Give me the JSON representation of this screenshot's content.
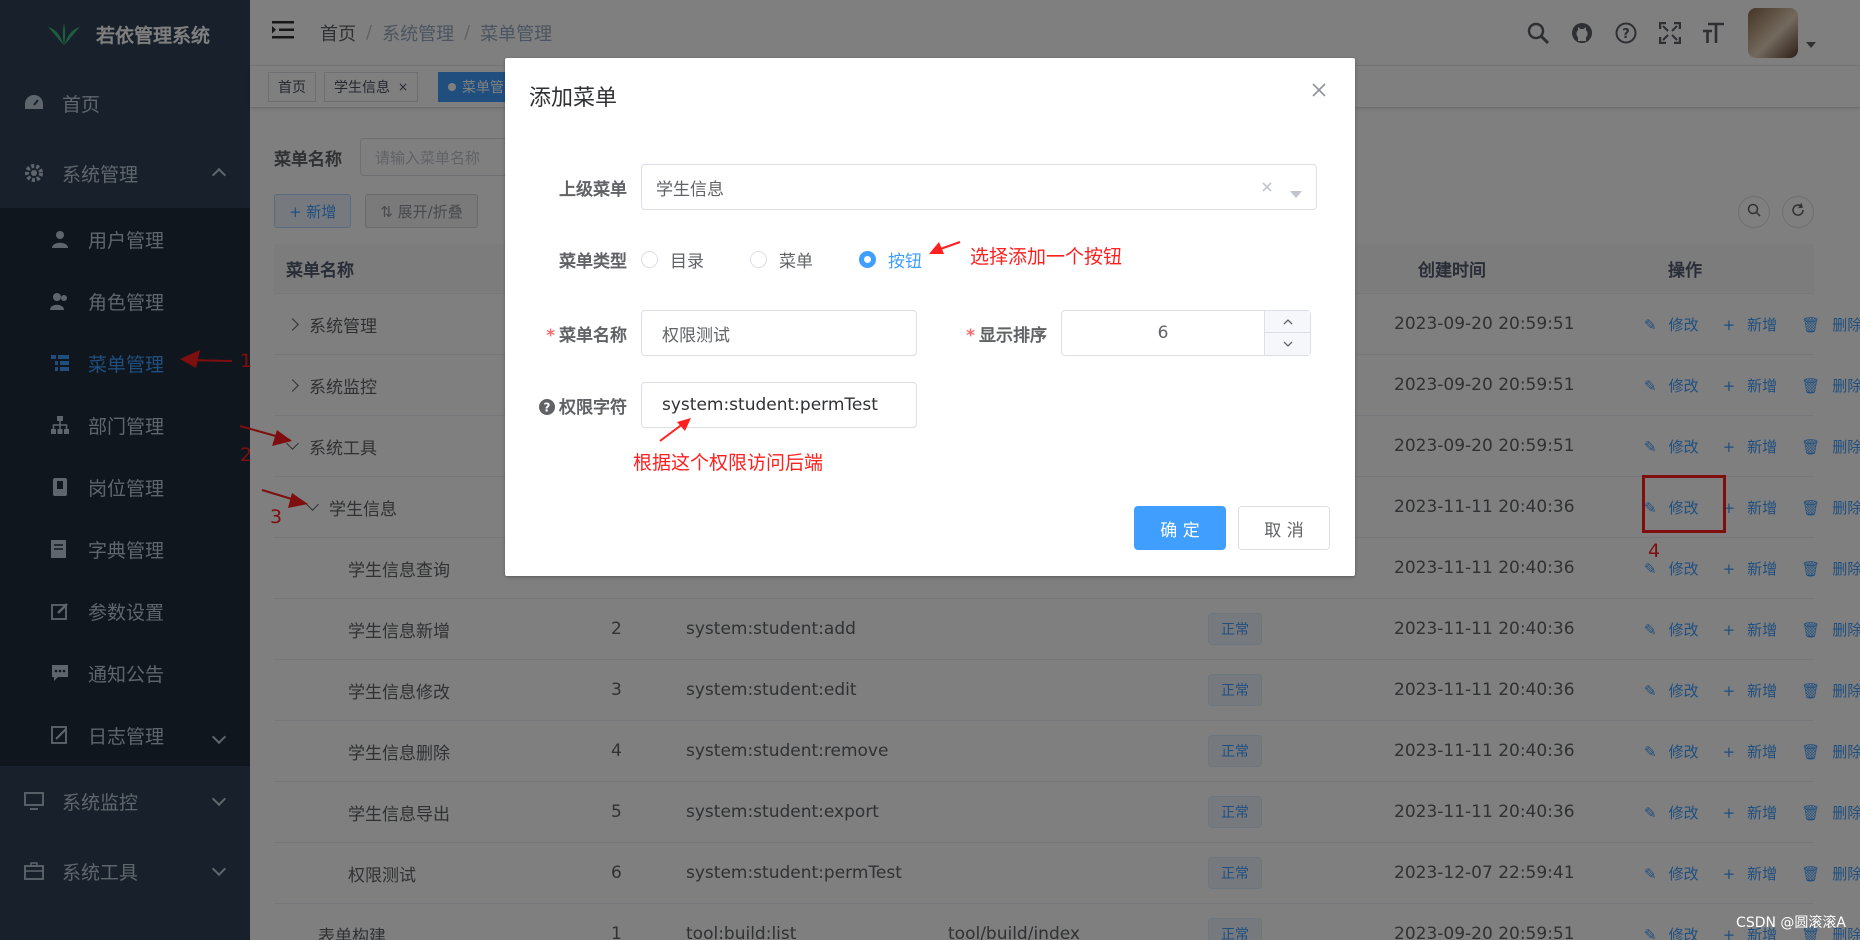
{
  "sidebar": {
    "logo": "若依管理系统",
    "items": [
      {
        "label": "首页",
        "icon": "dashboard-icon"
      },
      {
        "label": "系统管理",
        "icon": "gear-icon",
        "expanded": true
      },
      {
        "label": "系统监控",
        "icon": "monitor-icon"
      },
      {
        "label": "系统工具",
        "icon": "toolbox-icon"
      }
    ],
    "sub_items": [
      {
        "label": "用户管理",
        "icon": "user-icon"
      },
      {
        "label": "角色管理",
        "icon": "users-icon"
      },
      {
        "label": "菜单管理",
        "icon": "tree-table-icon",
        "active": true
      },
      {
        "label": "部门管理",
        "icon": "org-icon"
      },
      {
        "label": "岗位管理",
        "icon": "badge-icon"
      },
      {
        "label": "字典管理",
        "icon": "book-icon"
      },
      {
        "label": "参数设置",
        "icon": "edit-icon"
      },
      {
        "label": "通知公告",
        "icon": "message-icon"
      },
      {
        "label": "日志管理",
        "icon": "log-icon"
      }
    ]
  },
  "header": {
    "breadcrumb": [
      "首页",
      "系统管理",
      "菜单管理"
    ],
    "separator": "/"
  },
  "tags": [
    {
      "label": "首页"
    },
    {
      "label": "学生信息",
      "close": "×"
    },
    {
      "label": "菜单管理"
    }
  ],
  "search": {
    "label": "菜单名称",
    "placeholder": "请输入菜单名称"
  },
  "toolbar": {
    "add": "+ 新增",
    "expand": "⇅ 展开/折叠"
  },
  "table": {
    "headers": {
      "name": "菜单名称",
      "created": "创建时间",
      "ops": "操作"
    },
    "op_labels": {
      "edit": "修改",
      "add": "新增",
      "delete": "删除"
    },
    "rows": [
      {
        "name": "系统管理",
        "order": "",
        "perm": "",
        "comp": "",
        "status": "",
        "created": "2023-09-20 20:59:51",
        "tree": "collapsed",
        "level": 0
      },
      {
        "name": "系统监控",
        "order": "",
        "perm": "",
        "comp": "",
        "status": "",
        "created": "2023-09-20 20:59:51",
        "tree": "collapsed",
        "level": 0
      },
      {
        "name": "系统工具",
        "order": "",
        "perm": "",
        "comp": "",
        "status": "",
        "created": "2023-09-20 20:59:51",
        "tree": "expanded",
        "level": 0
      },
      {
        "name": "学生信息",
        "order": "",
        "perm": "",
        "comp": "",
        "status": "",
        "created": "2023-11-11 20:40:36",
        "tree": "expanded",
        "level": 1
      },
      {
        "name": "学生信息查询",
        "order": "",
        "perm": "",
        "comp": "",
        "status": "",
        "created": "2023-11-11 20:40:36",
        "tree": "none",
        "level": 2
      },
      {
        "name": "学生信息新增",
        "order": "2",
        "perm": "system:student:add",
        "comp": "",
        "status": "正常",
        "created": "2023-11-11 20:40:36",
        "tree": "none",
        "level": 2
      },
      {
        "name": "学生信息修改",
        "order": "3",
        "perm": "system:student:edit",
        "comp": "",
        "status": "正常",
        "created": "2023-11-11 20:40:36",
        "tree": "none",
        "level": 2
      },
      {
        "name": "学生信息删除",
        "order": "4",
        "perm": "system:student:remove",
        "comp": "",
        "status": "正常",
        "created": "2023-11-11 20:40:36",
        "tree": "none",
        "level": 2
      },
      {
        "name": "学生信息导出",
        "order": "5",
        "perm": "system:student:export",
        "comp": "",
        "status": "正常",
        "created": "2023-11-11 20:40:36",
        "tree": "none",
        "level": 2
      },
      {
        "name": "权限测试",
        "order": "6",
        "perm": "system:student:permTest",
        "comp": "",
        "status": "正常",
        "created": "2023-12-07 22:59:41",
        "tree": "none",
        "level": 2
      },
      {
        "name": "表单构建",
        "order": "1",
        "perm": "tool:build:list",
        "comp": "tool/build/index",
        "status": "正常",
        "created": "2023-09-20 20:59:51",
        "tree": "none",
        "level": 1
      }
    ]
  },
  "dialog": {
    "title": "添加菜单",
    "parent": {
      "label": "上级菜单",
      "value": "学生信息"
    },
    "type": {
      "label": "菜单类型",
      "options": [
        "目录",
        "菜单",
        "按钮"
      ],
      "selected": "按钮"
    },
    "name": {
      "label": "菜单名称",
      "value": "权限测试"
    },
    "order": {
      "label": "显示排序",
      "value": "6"
    },
    "perm": {
      "label": "权限字符",
      "value": "system:student:permTest"
    },
    "ok": "确 定",
    "cancel": "取 消"
  },
  "annotations": {
    "n1": "1",
    "n2": "2",
    "n3": "3",
    "n4": "4",
    "select_button": "选择添加一个按钮",
    "perm_note": "根据这个权限访问后端"
  },
  "watermark": "CSDN @圆滚滚A",
  "colors": {
    "primary": "#409eff",
    "sidebar": "#304156",
    "annotation": "#ff1f1f"
  }
}
